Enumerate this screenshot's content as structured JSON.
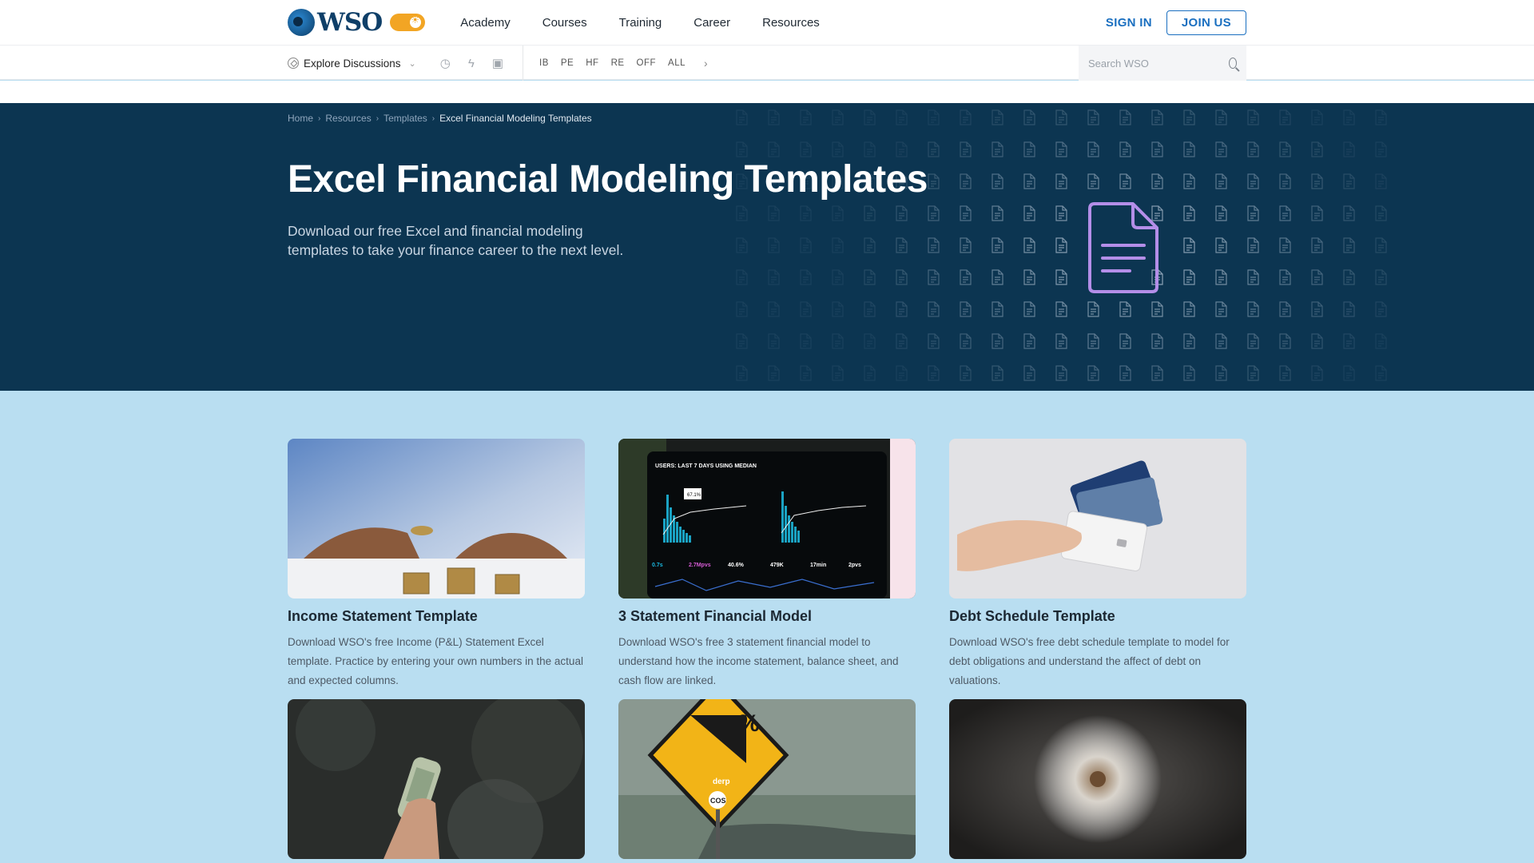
{
  "header": {
    "logo_text": "WSO",
    "nav": [
      "Academy",
      "Courses",
      "Training",
      "Career",
      "Resources"
    ],
    "sign_in": "SIGN IN",
    "join_us": "JOIN US"
  },
  "subnav": {
    "explore": "Explore Discussions",
    "icons": [
      "clock-icon",
      "lightning-icon",
      "video-icon"
    ],
    "categories": [
      "IB",
      "PE",
      "HF",
      "RE",
      "OFF",
      "ALL"
    ],
    "search_placeholder": "Search WSO"
  },
  "hero": {
    "breadcrumb": [
      "Home",
      "Resources",
      "Templates",
      "Excel Financial Modeling Templates"
    ],
    "title": "Excel Financial Modeling Templates",
    "description": "Download our free Excel and financial modeling templates to take your finance career to the next level.",
    "icon": "document-icon"
  },
  "cards": [
    {
      "title": "Income Statement Template",
      "description": "Download WSO's free Income (P&L) Statement Excel template. Practice by entering your own numbers in the actual and expected columns.",
      "image": "coin-stacks-photo"
    },
    {
      "title": "3 Statement Financial Model",
      "description": "Download WSO's free 3 statement financial model to understand how the income statement, balance sheet, and cash flow are linked.",
      "image": "analytics-dashboard-photo",
      "image_text": [
        "USERS: LAST 7 DAYS USING MEDIAN",
        "67.1%",
        "0.7s",
        "2.7Mpvs",
        "40.6%",
        "479K",
        "17min",
        "2pvs"
      ]
    },
    {
      "title": "Debt Schedule Template",
      "description": "Download WSO's free debt schedule template to model for debt obligations and understand the affect of debt on valuations.",
      "image": "credit-cards-photo"
    },
    {
      "title": "",
      "description": "",
      "image": "rolled-dollar-bill-photo"
    },
    {
      "title": "",
      "description": "",
      "image": "road-sign-photo",
      "image_text": [
        "%",
        "derp",
        "COS"
      ]
    },
    {
      "title": "",
      "description": "",
      "image": "dandelion-photo"
    }
  ]
}
